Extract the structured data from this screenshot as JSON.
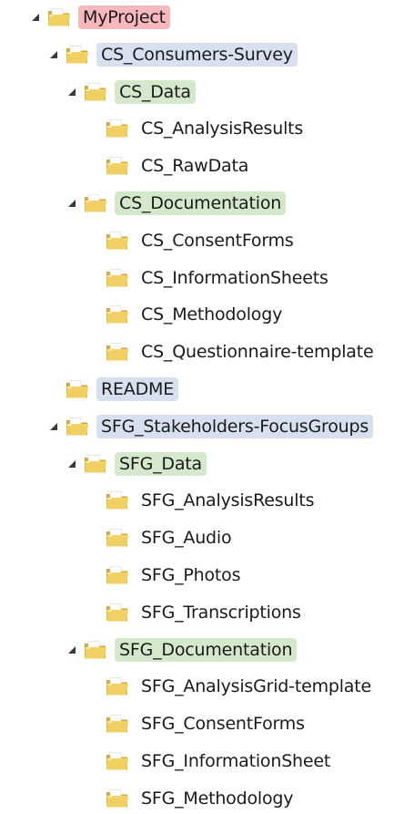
{
  "tree": {
    "nodes": [
      {
        "label": "MyProject",
        "highlight": "red",
        "expanded": true,
        "level": 0
      },
      {
        "label": "CS_Consumers-Survey",
        "highlight": "blue",
        "expanded": true,
        "level": 1
      },
      {
        "label": "CS_Data",
        "highlight": "green",
        "expanded": true,
        "level": 2
      },
      {
        "label": "CS_AnalysisResults",
        "highlight": "none",
        "expanded": null,
        "level": 3
      },
      {
        "label": "CS_RawData",
        "highlight": "none",
        "expanded": null,
        "level": 3
      },
      {
        "label": "CS_Documentation",
        "highlight": "green",
        "expanded": true,
        "level": 2
      },
      {
        "label": "CS_ConsentForms",
        "highlight": "none",
        "expanded": null,
        "level": 3
      },
      {
        "label": "CS_InformationSheets",
        "highlight": "none",
        "expanded": null,
        "level": 3
      },
      {
        "label": "CS_Methodology",
        "highlight": "none",
        "expanded": null,
        "level": 3
      },
      {
        "label": "CS_Questionnaire-template",
        "highlight": "none",
        "expanded": null,
        "level": 3
      },
      {
        "label": "README",
        "highlight": "blue",
        "expanded": null,
        "level": 1
      },
      {
        "label": "SFG_Stakeholders-FocusGroups",
        "highlight": "blue",
        "expanded": true,
        "level": 1
      },
      {
        "label": "SFG_Data",
        "highlight": "green",
        "expanded": true,
        "level": 2
      },
      {
        "label": "SFG_AnalysisResults",
        "highlight": "none",
        "expanded": null,
        "level": 3
      },
      {
        "label": "SFG_Audio",
        "highlight": "none",
        "expanded": null,
        "level": 3
      },
      {
        "label": "SFG_Photos",
        "highlight": "none",
        "expanded": null,
        "level": 3
      },
      {
        "label": "SFG_Transcriptions",
        "highlight": "none",
        "expanded": null,
        "level": 3
      },
      {
        "label": "SFG_Documentation",
        "highlight": "green",
        "expanded": true,
        "level": 2
      },
      {
        "label": "SFG_AnalysisGrid-template",
        "highlight": "none",
        "expanded": null,
        "level": 3
      },
      {
        "label": "SFG_ConsentForms",
        "highlight": "none",
        "expanded": null,
        "level": 3
      },
      {
        "label": "SFG_InformationSheet",
        "highlight": "none",
        "expanded": null,
        "level": 3
      },
      {
        "label": "SFG_Methodology",
        "highlight": "none",
        "expanded": null,
        "level": 3
      }
    ]
  },
  "colors": {
    "highlight_red": "#f6b8bc",
    "highlight_blue": "#d6e0ef",
    "highlight_green": "#d4e9cc",
    "folder_main": "#f1cf63",
    "folder_dark": "#d4a73a",
    "folder_light": "#fbe8a6",
    "expander": "#3a3a3a"
  },
  "icons": {
    "folder": "folder-icon",
    "expanded": "expanded-triangle-icon"
  }
}
